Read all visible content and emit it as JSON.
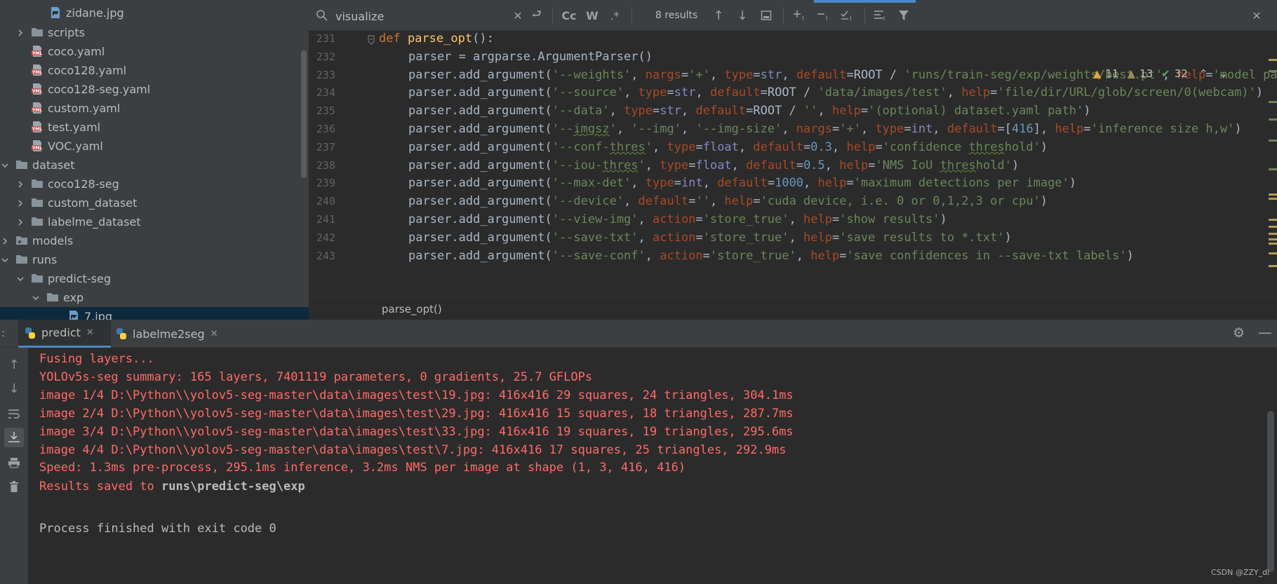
{
  "project_tree": {
    "items": [
      {
        "label": "zidane.jpg",
        "icon": "image-file-icon",
        "expand": ""
      },
      {
        "label": "scripts",
        "icon": "folder-icon",
        "expand": "collapsed"
      },
      {
        "label": "coco.yaml",
        "icon": "yaml-file-icon",
        "expand": ""
      },
      {
        "label": "coco128.yaml",
        "icon": "yaml-file-icon",
        "expand": ""
      },
      {
        "label": "coco128-seg.yaml",
        "icon": "yaml-file-icon",
        "expand": ""
      },
      {
        "label": "custom.yaml",
        "icon": "yaml-file-icon",
        "expand": ""
      },
      {
        "label": "test.yaml",
        "icon": "yaml-file-icon",
        "expand": ""
      },
      {
        "label": "VOC.yaml",
        "icon": "yaml-file-icon",
        "expand": ""
      },
      {
        "label": "dataset",
        "icon": "folder-icon",
        "expand": "expanded"
      },
      {
        "label": "coco128-seg",
        "icon": "folder-icon",
        "expand": "collapsed"
      },
      {
        "label": "custom_dataset",
        "icon": "folder-icon",
        "expand": "collapsed"
      },
      {
        "label": "labelme_dataset",
        "icon": "folder-icon",
        "expand": "collapsed"
      },
      {
        "label": "models",
        "icon": "package-folder-icon",
        "expand": "collapsed"
      },
      {
        "label": "runs",
        "icon": "folder-icon",
        "expand": "expanded"
      },
      {
        "label": "predict-seg",
        "icon": "folder-icon",
        "expand": "expanded"
      },
      {
        "label": "exp",
        "icon": "folder-icon",
        "expand": "expanded"
      },
      {
        "label": "7.jpg",
        "icon": "image-file-icon",
        "expand": ""
      }
    ]
  },
  "find_bar": {
    "query": "visualize",
    "results": "8 results",
    "match_case": "Cc",
    "words": "W",
    "regex": ".*"
  },
  "editor": {
    "inspections": {
      "warnings": "11",
      "weak_warnings": "13",
      "ok": "32"
    },
    "line_numbers": [
      "231",
      "232",
      "233",
      "234",
      "235",
      "236",
      "237",
      "238",
      "239",
      "240",
      "241",
      "242",
      "243"
    ],
    "lines": [
      "def parse_opt():",
      "parser = argparse.ArgumentParser()",
      "parser.add_argument('--weights', nargs='+', type=str, default=ROOT / 'runs/train-seg/exp/weights/best.pt', help='model path(s)')",
      "parser.add_argument('--source', type=str, default=ROOT / 'data/images/test', help='file/dir/URL/glob/screen/0(webcam)')",
      "parser.add_argument('--data', type=str, default=ROOT / '', help='(optional) dataset.yaml path')",
      "parser.add_argument('--imgsz', '--img', '--img-size', nargs='+', type=int, default=[416], help='inference size h,w')",
      "parser.add_argument('--conf-thres', type=float, default=0.3, help='confidence threshold')",
      "parser.add_argument('--iou-thres', type=float, default=0.5, help='NMS IoU threshold')",
      "parser.add_argument('--max-det', type=int, default=1000, help='maximum detections per image')",
      "parser.add_argument('--device', default='', help='cuda device, i.e. 0 or 0,1,2,3 or cpu')",
      "parser.add_argument('--view-img', action='store_true', help='show results')",
      "parser.add_argument('--save-txt', action='store_true', help='save results to *.txt')",
      "parser.add_argument('--save-conf', action='store_true', help='save confidences in --save-txt labels')"
    ],
    "breadcrumb": "parse_opt()"
  },
  "run_window": {
    "tabs": [
      {
        "label": "predict",
        "active": true
      },
      {
        "label": "labelme2seg",
        "active": false
      }
    ],
    "console_lines": [
      "Fusing layers...",
      "YOLOv5s-seg summary: 165 layers, 7401119 parameters, 0 gradients, 25.7 GFLOPs",
      "image 1/4 D:\\Python\\\\yolov5-seg-master\\data\\images\\test\\19.jpg: 416x416 29 squares, 24 triangles, 304.1ms",
      "image 2/4 D:\\Python\\\\yolov5-seg-master\\data\\images\\test\\29.jpg: 416x416 15 squares, 18 triangles, 287.7ms",
      "image 3/4 D:\\Python\\\\yolov5-seg-master\\data\\images\\test\\33.jpg: 416x416 19 squares, 19 triangles, 295.6ms",
      "image 4/4 D:\\Python\\\\yolov5-seg-master\\data\\images\\test\\7.jpg: 416x416 17 squares, 25 triangles, 292.9ms",
      "Speed: 1.3ms pre-process, 295.1ms inference, 3.2ms NMS per image at shape (1, 3, 416, 416)"
    ],
    "saved_prefix": "Results saved to ",
    "saved_path": "runs\\predict-seg\\exp",
    "finished": "Process finished with exit code 0"
  },
  "watermark": "CSDN @ZZY_dl",
  "colors": {
    "background": "#2b2b2b",
    "panel": "#3c3f41",
    "keyword": "#cc7832",
    "string": "#6a8759",
    "number": "#6897bb",
    "console_error": "#ff6b68",
    "selection": "#0d293e",
    "accent": "#4a88c7"
  }
}
